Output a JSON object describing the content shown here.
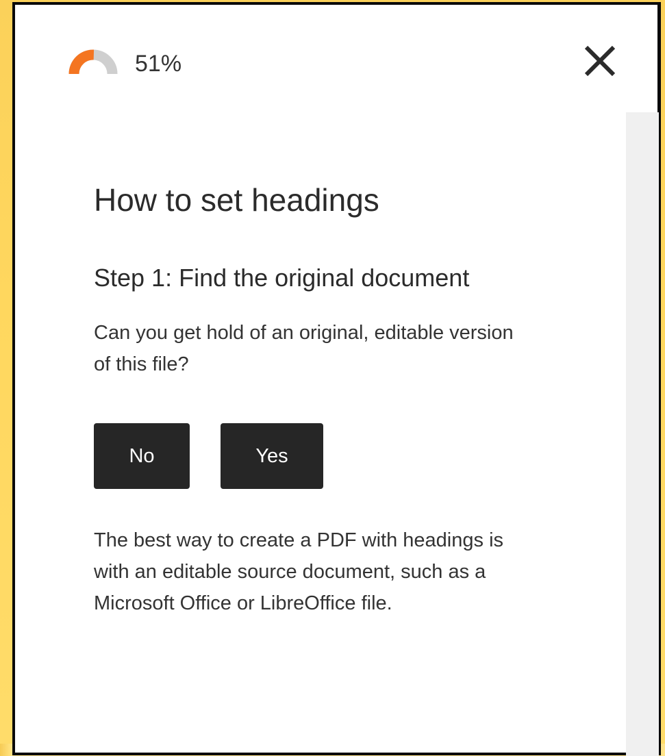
{
  "progress": {
    "percent_text": "51%",
    "value": 0.51,
    "fill_color": "#f47521",
    "track_color": "#cfcfcf"
  },
  "close": {
    "icon": "close-icon"
  },
  "dialog": {
    "title": "How to set headings",
    "step_title": "Step 1: Find the original document",
    "question": "Can you get hold of an original, editable version of this file?",
    "buttons": {
      "no_label": "No",
      "yes_label": "Yes"
    },
    "info": "The best way to create a PDF with headings is with an editable source document, such as a Microsoft Office or LibreOffice file."
  }
}
